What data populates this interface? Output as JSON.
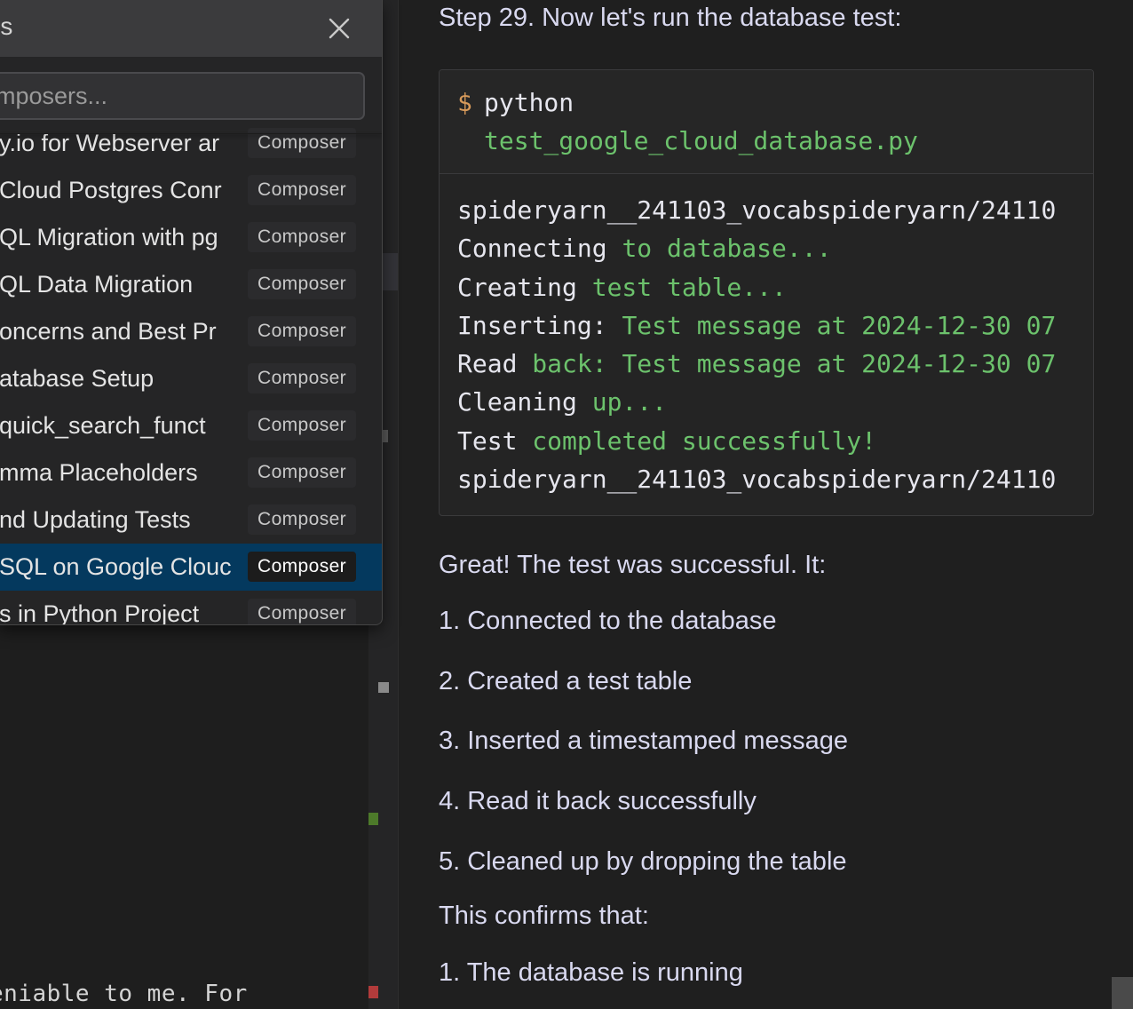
{
  "editor": {
    "bottom_code": "eniable to me. For"
  },
  "composer_popup": {
    "title": "rs",
    "search_placeholder": "mposers...",
    "items": [
      {
        "name": "y.io for Webserver ar",
        "tag": "Composer",
        "selected": false
      },
      {
        "name": "Cloud Postgres Conr",
        "tag": "Composer",
        "selected": false
      },
      {
        "name": "QL Migration with pg",
        "tag": "Composer",
        "selected": false
      },
      {
        "name": "QL Data Migration",
        "tag": "Composer",
        "selected": false
      },
      {
        "name": "oncerns and Best Pr",
        "tag": "Composer",
        "selected": false
      },
      {
        "name": "atabase Setup",
        "tag": "Composer",
        "selected": false
      },
      {
        "name": "quick_search_funct",
        "tag": "Composer",
        "selected": false
      },
      {
        "name": "mma Placeholders",
        "tag": "Composer",
        "selected": false
      },
      {
        "name": "nd Updating Tests",
        "tag": "Composer",
        "selected": false
      },
      {
        "name": "SQL on Google Clouc",
        "tag": "Composer",
        "selected": true
      },
      {
        "name": "s in Python Project",
        "tag": "Composer",
        "selected": false
      }
    ]
  },
  "chat": {
    "step_heading": "Step 29. Now let's run the database test:",
    "code_block": {
      "prompt_symbol": "$",
      "command_line1": "python",
      "command_line2": "test_google_cloud_database.py",
      "output": [
        {
          "w": "spideryarn__241103_vocabspideryarn/24110",
          "g": ""
        },
        {
          "w": "Connecting ",
          "g": "to database..."
        },
        {
          "w": "Creating ",
          "g": "test table..."
        },
        {
          "w": "Inserting: ",
          "g": "Test message at 2024-12-30 07"
        },
        {
          "w": "Read ",
          "g": "back: Test message at 2024-12-30 07"
        },
        {
          "w": "Cleaning ",
          "g": "up..."
        },
        {
          "w": "Test ",
          "g": "completed successfully!"
        },
        {
          "w": "spideryarn__241103_vocabspideryarn/24110",
          "g": ""
        }
      ]
    },
    "success_text": "Great! The test was successful. It:",
    "steps_list": [
      "1. Connected to the database",
      "2. Created a test table",
      "3. Inserted a timestamped message",
      "4. Read it back successfully",
      "5. Cleaned up by dropping the table"
    ],
    "confirm_text": "This confirms that:",
    "confirm_list": [
      "1. The database is running"
    ]
  }
}
